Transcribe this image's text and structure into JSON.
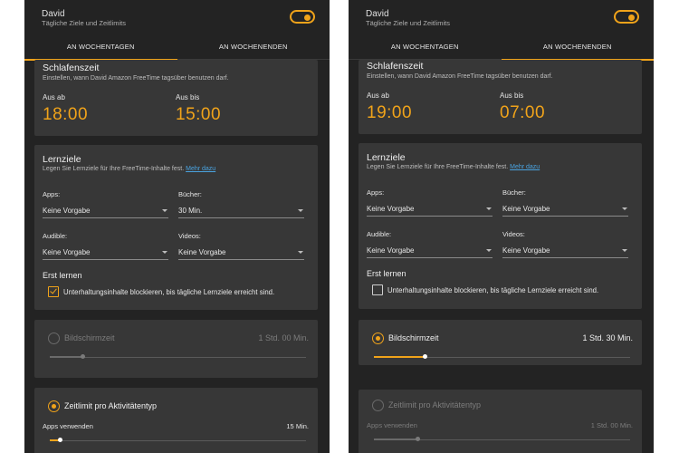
{
  "accent_color": "#f0a31a",
  "left": {
    "header": {
      "name": "David",
      "subtitle": "Tägliche Ziele und Zeitlimits"
    },
    "tabs": [
      {
        "label": "AN WOCHENTAGEN",
        "active": true
      },
      {
        "label": "AN WOCHENENDEN",
        "active": false
      }
    ],
    "bedtime": {
      "title": "Schlafenszeit",
      "description": "Einstellen, wann David Amazon FreeTime tagsüber benutzen darf.",
      "off_label": "Aus ab",
      "off_value": "18:00",
      "until_label": "Aus bis",
      "until_value": "15:00"
    },
    "learning": {
      "title": "Lernziele",
      "description": "Legen Sie Lernziele für Ihre FreeTime-Inhalte fest.",
      "more_link": "Mehr dazu",
      "apps_label": "Apps:",
      "apps_value": "Keine Vorgabe",
      "books_label": "Bücher:",
      "books_value": "30 Min.",
      "audible_label": "Audible:",
      "audible_value": "Keine Vorgabe",
      "videos_label": "Videos:",
      "videos_value": "Keine Vorgabe",
      "learn_first_title": "Erst lernen",
      "checkbox_label": "Unterhaltungsinhalte blockieren, bis tägliche Lernziele erreicht sind.",
      "checkbox_checked": true
    },
    "screen_time": {
      "label": "Bildschirmzeit",
      "value": "1 Std. 00 Min.",
      "selected": false,
      "slider_fraction": 0.13
    },
    "activity_limit": {
      "label": "Zeitlimit pro Aktivitätentyp",
      "selected": true,
      "apps_label": "Apps verwenden",
      "apps_value": "15 Min.",
      "apps_slider_fraction": 0.04
    }
  },
  "right": {
    "header": {
      "name": "David",
      "subtitle": "Tägliche Ziele und Zeitlimits"
    },
    "tabs": [
      {
        "label": "AN WOCHENTAGEN",
        "active": false
      },
      {
        "label": "AN WOCHENENDEN",
        "active": true
      }
    ],
    "bedtime": {
      "title": "Schlafenszeit",
      "description": "Einstellen, wann David Amazon FreeTime tagsüber benutzen darf.",
      "off_label": "Aus ab",
      "off_value": "19:00",
      "until_label": "Aus bis",
      "until_value": "07:00"
    },
    "learning": {
      "title": "Lernziele",
      "description": "Legen Sie Lernziele für Ihre FreeTime-Inhalte fest.",
      "more_link": "Mehr dazu",
      "apps_label": "Apps:",
      "apps_value": "Keine Vorgabe",
      "books_label": "Bücher:",
      "books_value": "Keine Vorgabe",
      "audible_label": "Audible:",
      "audible_value": "Keine Vorgabe",
      "videos_label": "Videos:",
      "videos_value": "Keine Vorgabe",
      "learn_first_title": "Erst lernen",
      "checkbox_label": "Unterhaltungsinhalte blockieren, bis tägliche Lernziele erreicht sind.",
      "checkbox_checked": false
    },
    "screen_time": {
      "label": "Bildschirmzeit",
      "value": "1 Std. 30 Min.",
      "selected": true,
      "slider_fraction": 0.2
    },
    "activity_limit": {
      "label": "Zeitlimit pro Aktivitätentyp",
      "selected": false,
      "apps_label": "Apps verwenden",
      "apps_value": "1 Std. 00 Min.",
      "apps_slider_fraction": 0.17
    }
  }
}
